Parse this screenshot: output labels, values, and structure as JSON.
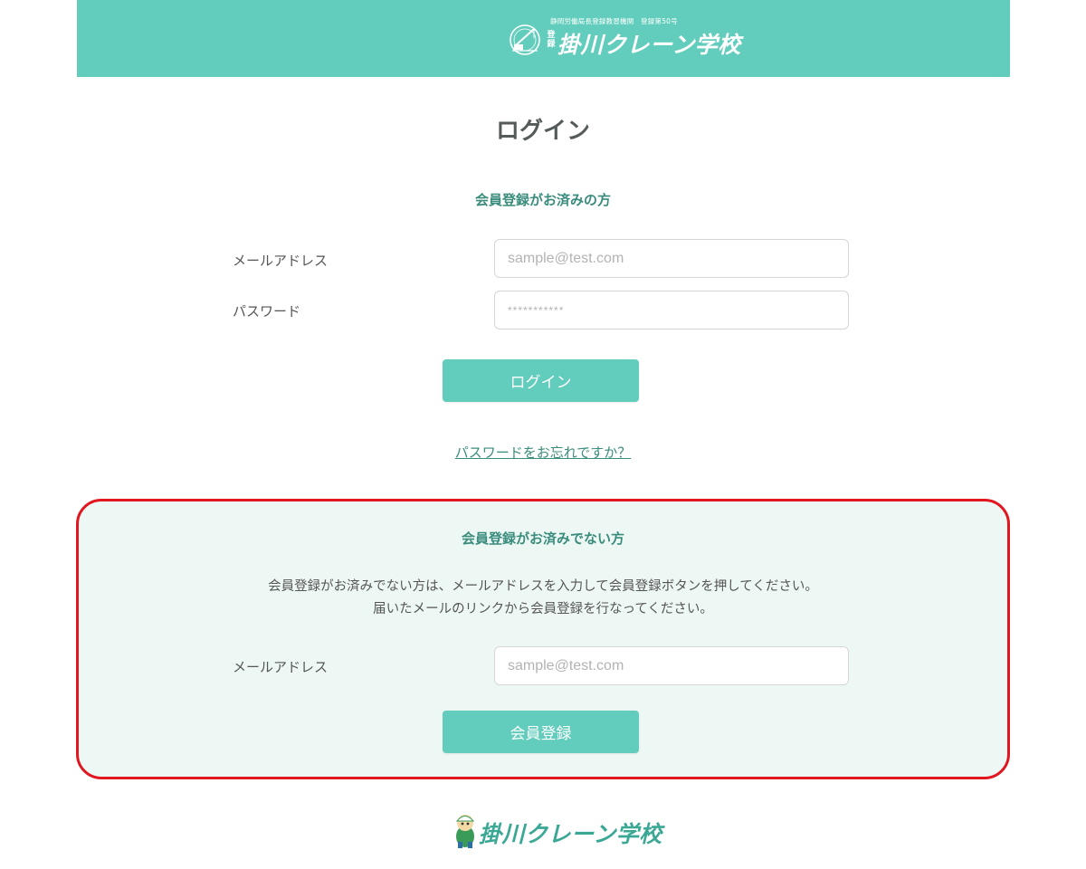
{
  "header": {
    "tagline": "静岡労働局長登録教習機関　登録第50号",
    "registered_mark": "登録",
    "school_name": "掛川クレーン学校"
  },
  "page_title": "ログイン",
  "member_login": {
    "title": "会員登録がお済みの方",
    "email_label": "メールアドレス",
    "email_placeholder": "sample@test.com",
    "password_label": "パスワード",
    "password_placeholder": "***********",
    "login_button": "ログイン",
    "forgot_link": "パスワードをお忘れですか？"
  },
  "register": {
    "title": "会員登録がお済みでない方",
    "description_line1": "会員登録がお済みでない方は、メールアドレスを入力して会員登録ボタンを押してください。",
    "description_line2": "届いたメールのリンクから会員登録を行なってください。",
    "email_label": "メールアドレス",
    "email_placeholder": "sample@test.com",
    "register_button": "会員登録"
  },
  "footer": {
    "school_name": "掛川クレーン学校"
  },
  "colors": {
    "brand": "#62cdbc",
    "accent_text": "#3a8c7c",
    "highlight_border": "#e1161f",
    "register_background": "#edf8f5"
  },
  "icons": {
    "header_emblem": "crane-emblem-icon",
    "footer_mascot": "mascot-icon"
  }
}
